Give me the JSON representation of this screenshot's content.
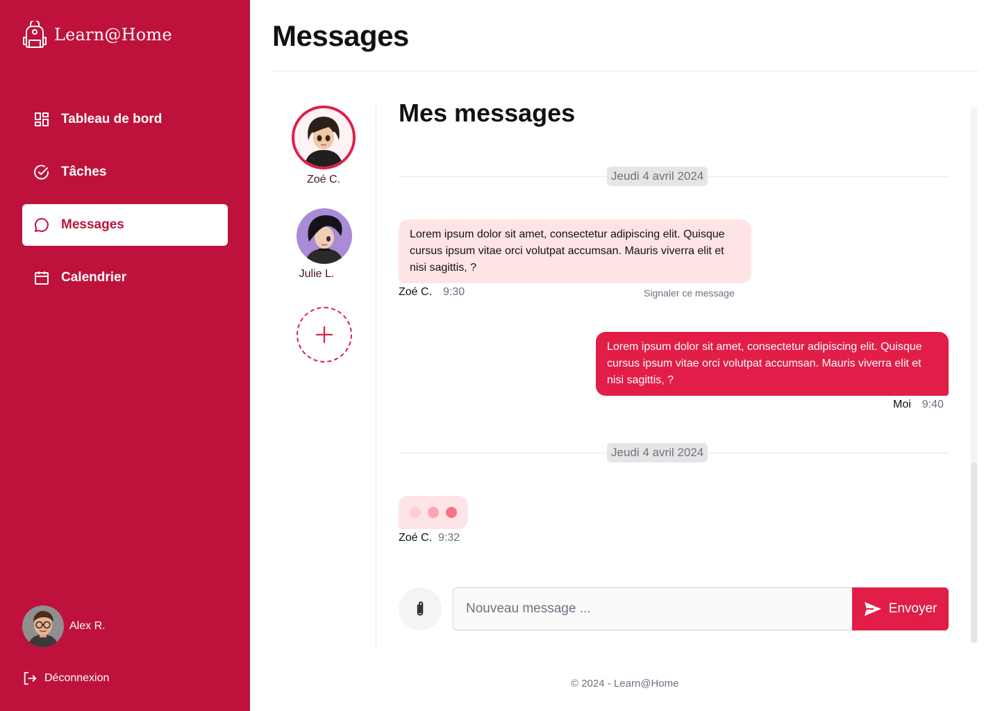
{
  "brand": {
    "name": "Learn@Home",
    "logo_icon": "backpack-icon"
  },
  "sidebar": {
    "items": [
      {
        "label": "Tableau de bord",
        "icon": "dashboard-icon",
        "active": false
      },
      {
        "label": "Tâches",
        "icon": "check-circle-icon",
        "active": false
      },
      {
        "label": "Messages",
        "icon": "chat-bubble-icon",
        "active": true
      },
      {
        "label": "Calendrier",
        "icon": "calendar-icon",
        "active": false
      }
    ],
    "user": {
      "name": "Alex R."
    },
    "logout_label": "Déconnexion"
  },
  "header": {
    "title": "Messages"
  },
  "contacts": [
    {
      "name": "Zoé C.",
      "selected": true
    },
    {
      "name": "Julie L.",
      "selected": false
    }
  ],
  "chat": {
    "title": "Mes messages",
    "date_separators": [
      "Jeudi 4 avril 2024",
      "Jeudi 4 avril 2024"
    ],
    "messages": [
      {
        "direction": "incoming",
        "text": "Lorem ipsum dolor sit amet, consectetur adipiscing elit. Quisque cursus ipsum vitae orci volutpat accumsan. Mauris viverra elit et nisi sagittis, ?",
        "author": "Zoé C.",
        "time": "9:30",
        "report_label": "Signaler ce message"
      },
      {
        "direction": "outgoing",
        "text": "Lorem ipsum dolor sit amet, consectetur adipiscing elit. Quisque cursus ipsum vitae orci volutpat accumsan. Mauris viverra elit et nisi sagittis, ?",
        "author": "Moi",
        "time": "9:40"
      }
    ],
    "typing": {
      "author": "Zoé C.",
      "time": "9:32"
    }
  },
  "composer": {
    "placeholder": "Nouveau message ...",
    "value": "",
    "send_label": "Envoyer"
  },
  "footer": {
    "text": "© 2024 - Learn@Home"
  },
  "colors": {
    "brand": "#be123c",
    "accent": "#e11d48",
    "bubble_incoming": "#ffe4e6",
    "muted": "#6b7280"
  }
}
